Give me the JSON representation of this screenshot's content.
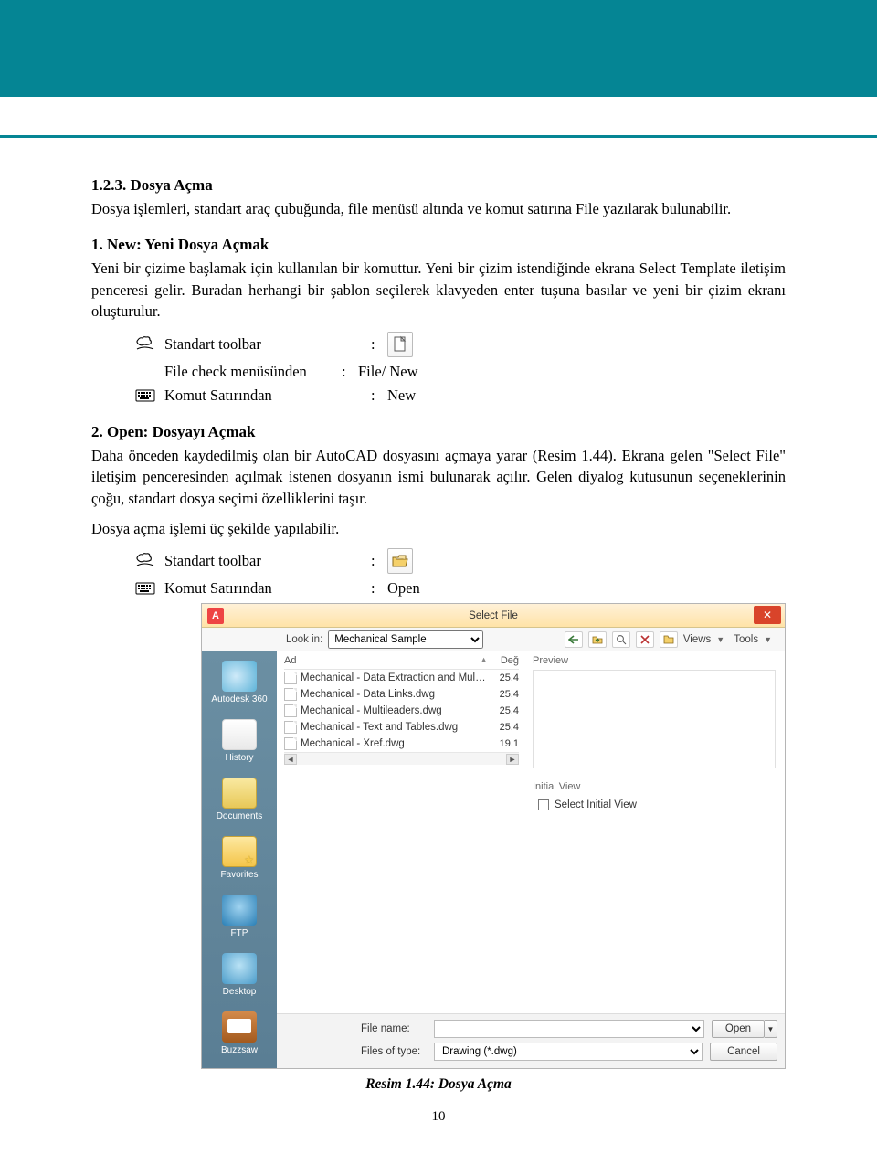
{
  "section1": {
    "number_title": "1.2.3. Dosya Açma",
    "para": "Dosya işlemleri, standart araç çubuğunda, file menüsü altında ve komut satırına File yazılarak bulunabilir."
  },
  "sub1": {
    "title": "1. New: Yeni Dosya Açmak",
    "para": "Yeni bir çizime başlamak için kullanılan bir komuttur. Yeni bir çizim istendiğinde ekrana Select Template iletişim penceresi gelir. Buradan herhangi bir şablon seçilerek klavyeden enter tuşuna basılar ve yeni bir çizim ekranı oluşturulur.",
    "line1_label": "Standart toolbar",
    "line1_value": "",
    "line2_label": "File check menüsünden",
    "line2_value": "File/ New",
    "line3_label": "Komut Satırından",
    "line3_value": "New"
  },
  "sub2": {
    "title": "2. Open: Dosyayı Açmak",
    "para1": "Daha önceden kaydedilmiş olan bir AutoCAD dosyasını açmaya yarar (Resim 1.44). Ekrana gelen \"Select File\" iletişim penceresinden açılmak istenen dosyanın ismi bulunarak açılır. Gelen diyalog kutusunun seçeneklerinin çoğu, standart dosya seçimi özelliklerini taşır.",
    "para2": "Dosya açma işlemi üç şekilde yapılabilir.",
    "line1_label": "Standart toolbar",
    "line2_label": "Komut Satırından",
    "line2_value": "Open"
  },
  "dialog": {
    "title": "Select File",
    "lookin_label": "Look in:",
    "lookin_value": "Mechanical Sample",
    "views": "Views",
    "tools": "Tools",
    "col_name": "Ad",
    "col_date": "Değ",
    "preview_label": "Preview",
    "initialview_label": "Initial View",
    "initialview_check": "Select Initial View",
    "filename_label": "File name:",
    "filename_value": "",
    "filetype_label": "Files of type:",
    "filetype_value": "Drawing (*.dwg)",
    "open_btn": "Open",
    "cancel_btn": "Cancel",
    "places": [
      "Autodesk 360",
      "History",
      "Documents",
      "Favorites",
      "FTP",
      "Desktop",
      "Buzzsaw"
    ],
    "files": [
      {
        "name": "Mechanical - Data Extraction and Multileade...",
        "size": "25.4"
      },
      {
        "name": "Mechanical - Data Links.dwg",
        "size": "25.4"
      },
      {
        "name": "Mechanical - Multileaders.dwg",
        "size": "25.4"
      },
      {
        "name": "Mechanical - Text and Tables.dwg",
        "size": "25.4"
      },
      {
        "name": "Mechanical - Xref.dwg",
        "size": "19.1"
      }
    ]
  },
  "caption": "Resim 1.44: Dosya Açma",
  "pagenum": "10"
}
